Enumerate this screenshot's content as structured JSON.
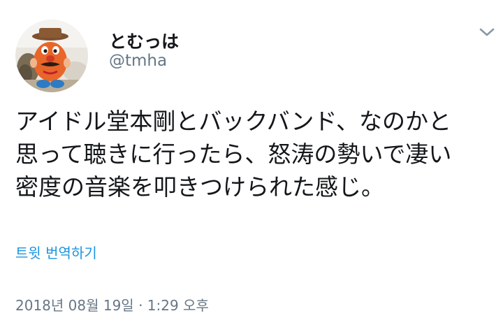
{
  "author": {
    "display_name": "とむっは",
    "handle": "@tmha",
    "avatar_icon": "mr-potato-head-avatar-icon"
  },
  "menu_icon": "chevron-down-icon",
  "tweet": {
    "text": "アイドル堂本剛とバックバンド、なのかと\n思って聴きに行ったら、怒涛の勢いで凄い\n密度の音楽を叩きつけられた感じ。"
  },
  "translate_label": "트윗 번역하기",
  "timestamp": "2018년 08월 19일 · 1:29 오후",
  "colors": {
    "link": "#1b95e0",
    "secondary_text": "#657786",
    "primary_text": "#14171a"
  }
}
